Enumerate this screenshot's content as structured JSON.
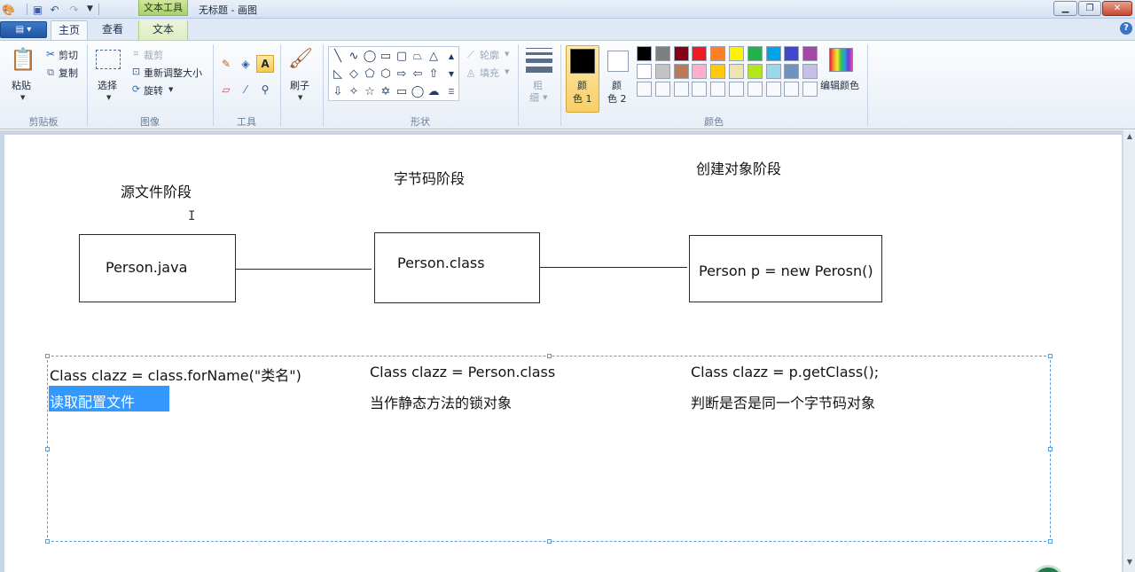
{
  "title_bar": {
    "context_tab": "文本工具",
    "window_title": "无标题 - 画图"
  },
  "tabs": {
    "home": "主页",
    "view": "查看",
    "text": "文本"
  },
  "groups": {
    "clipboard": {
      "label": "剪贴板",
      "paste": "粘贴",
      "cut": "剪切",
      "copy": "复制"
    },
    "image": {
      "label": "图像",
      "select": "选择",
      "crop": "裁剪",
      "resize": "重新调整大小",
      "rotate": "旋转"
    },
    "tools": {
      "label": "工具"
    },
    "brushes": {
      "label": "刷子"
    },
    "shapes": {
      "label": "形状",
      "outline": "轮廓",
      "fill": "填充"
    },
    "size": {
      "label_1": "粗",
      "label_2": "细"
    },
    "colors": {
      "label": "颜色",
      "color1_a": "颜",
      "color1_b": "色 1",
      "color2_a": "颜",
      "color2_b": "色 2",
      "edit": "编辑颜色",
      "palette_row1": [
        "#000000",
        "#7f7f7f",
        "#880015",
        "#ed1c24",
        "#ff7f27",
        "#fff200",
        "#22b14c",
        "#00a2e8",
        "#3f48cc",
        "#a349a4"
      ],
      "palette_row2": [
        "#ffffff",
        "#c3c3c3",
        "#b97a57",
        "#ffaec9",
        "#ffc90e",
        "#efe4b0",
        "#b5e61d",
        "#99d9ea",
        "#7092be",
        "#c8bfe7"
      ]
    }
  },
  "canvas": {
    "stage_labels": [
      "源文件阶段",
      "字节码阶段",
      "创建对象阶段"
    ],
    "boxes": [
      "Person.java",
      "Person.class",
      "Person p = new Perosn()"
    ],
    "code_lines": [
      "Class clazz = class.forName(\"类名\")",
      "Class clazz = Person.class",
      "Class clazz = p.getClass();"
    ],
    "notes": [
      "读取配置文件",
      "当作静态方法的锁对象",
      "判断是否是同一个字节码对象"
    ]
  }
}
